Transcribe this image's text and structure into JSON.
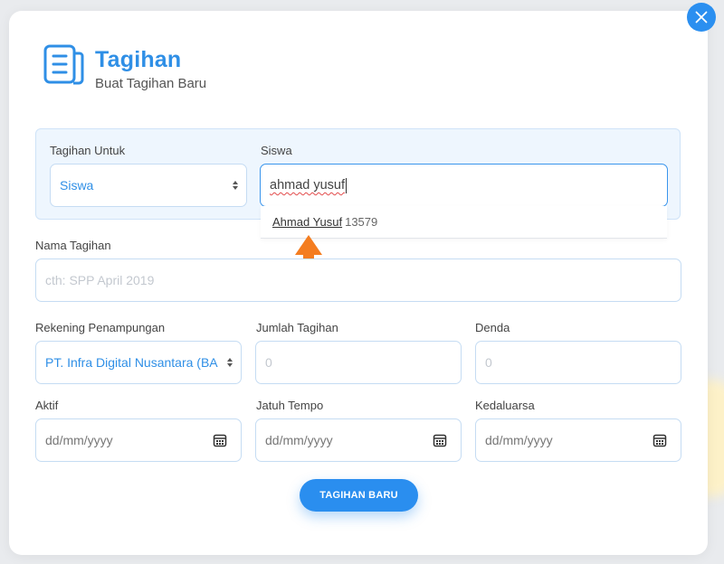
{
  "header": {
    "title": "Tagihan",
    "subtitle": "Buat Tagihan Baru"
  },
  "form": {
    "tagihan_untuk": {
      "label": "Tagihan Untuk",
      "value": "Siswa"
    },
    "siswa": {
      "label": "Siswa",
      "value": "ahmad yusuf",
      "suggestion": {
        "name": "Ahmad Yusuf",
        "nis": "13579"
      }
    },
    "nama_tagihan": {
      "label": "Nama Tagihan",
      "placeholder": "cth: SPP April 2019"
    },
    "rekening": {
      "label": "Rekening Penampungan",
      "value": "PT. Infra Digital Nusantara (BA"
    },
    "jumlah": {
      "label": "Jumlah Tagihan",
      "placeholder": "0"
    },
    "denda": {
      "label": "Denda",
      "placeholder": "0"
    },
    "aktif": {
      "label": "Aktif",
      "placeholder": "dd/mm/yyyy"
    },
    "jatuh_tempo": {
      "label": "Jatuh Tempo",
      "placeholder": "dd/mm/yyyy"
    },
    "kedaluarsa": {
      "label": "Kedaluarsa",
      "placeholder": "dd/mm/yyyy"
    }
  },
  "submit_label": "TAGIHAN BARU",
  "colors": {
    "accent": "#2a8eef",
    "arrow": "#f47d20"
  },
  "icons": {
    "close": "close-icon",
    "header": "document-icon",
    "calendar": "calendar-icon",
    "select_caret": "chevron-updown-icon"
  }
}
